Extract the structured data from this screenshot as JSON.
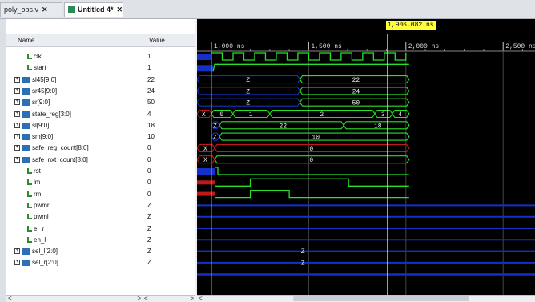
{
  "tabs": [
    {
      "label": "poly_obs.v",
      "close": "✕"
    },
    {
      "label": "Untitled 4*",
      "close": "✕"
    }
  ],
  "columns": {
    "name": "Name",
    "value": "Value"
  },
  "signals": [
    {
      "name": "clk",
      "value": "1",
      "kind": "bit"
    },
    {
      "name": "start",
      "value": "1",
      "kind": "bit"
    },
    {
      "name": "sl45[9:0]",
      "value": "22",
      "kind": "bus"
    },
    {
      "name": "sr45[9:0]",
      "value": "24",
      "kind": "bus"
    },
    {
      "name": "sr[9:0]",
      "value": "50",
      "kind": "bus"
    },
    {
      "name": "state_reg[3:0]",
      "value": "4",
      "kind": "bus"
    },
    {
      "name": "sl[9:0]",
      "value": "18",
      "kind": "bus"
    },
    {
      "name": "sm[9:0]",
      "value": "10",
      "kind": "bus"
    },
    {
      "name": "safe_reg_count[8:0]",
      "value": "0",
      "kind": "bus"
    },
    {
      "name": "safe_nxt_count[8:0]",
      "value": "0",
      "kind": "bus"
    },
    {
      "name": "rst",
      "value": "0",
      "kind": "bit"
    },
    {
      "name": "lm",
      "value": "0",
      "kind": "bit"
    },
    {
      "name": "rm",
      "value": "0",
      "kind": "bit"
    },
    {
      "name": "pwmr",
      "value": "Z",
      "kind": "bit"
    },
    {
      "name": "pwml",
      "value": "Z",
      "kind": "bit"
    },
    {
      "name": "el_r",
      "value": "Z",
      "kind": "bit"
    },
    {
      "name": "en_l",
      "value": "Z",
      "kind": "bit"
    },
    {
      "name": "sel_l[2:0]",
      "value": "Z",
      "kind": "bus"
    },
    {
      "name": "sel_r[2:0]",
      "value": "Z",
      "kind": "bus"
    }
  ],
  "timeline": {
    "ticks": [
      "1,000 ns",
      "1,500 ns",
      "2,000 ns",
      "2,500 ns"
    ],
    "cursor": "1,906.082 ns"
  },
  "wave_labels": {
    "sl45": [
      "Z",
      "22"
    ],
    "sr45": [
      "Z",
      "24"
    ],
    "sr": [
      "Z",
      "50"
    ],
    "state_reg": [
      "X",
      "0",
      "1",
      "2",
      "3",
      "4"
    ],
    "sl": [
      "Z",
      "22",
      "18"
    ],
    "sm": [
      "Z",
      "10"
    ],
    "safe_reg": [
      "X",
      "0"
    ],
    "safe_nxt": [
      "X",
      "0"
    ],
    "sel_l": "Z",
    "sel_r": "Z"
  },
  "scroll": {
    "left": "<",
    "right": ">"
  },
  "colors": {
    "wave_green": "#28e02a",
    "wave_red": "#c01818",
    "z_blue": "#1530c8",
    "cursor": "#ffff3a",
    "bg": "#000000"
  }
}
